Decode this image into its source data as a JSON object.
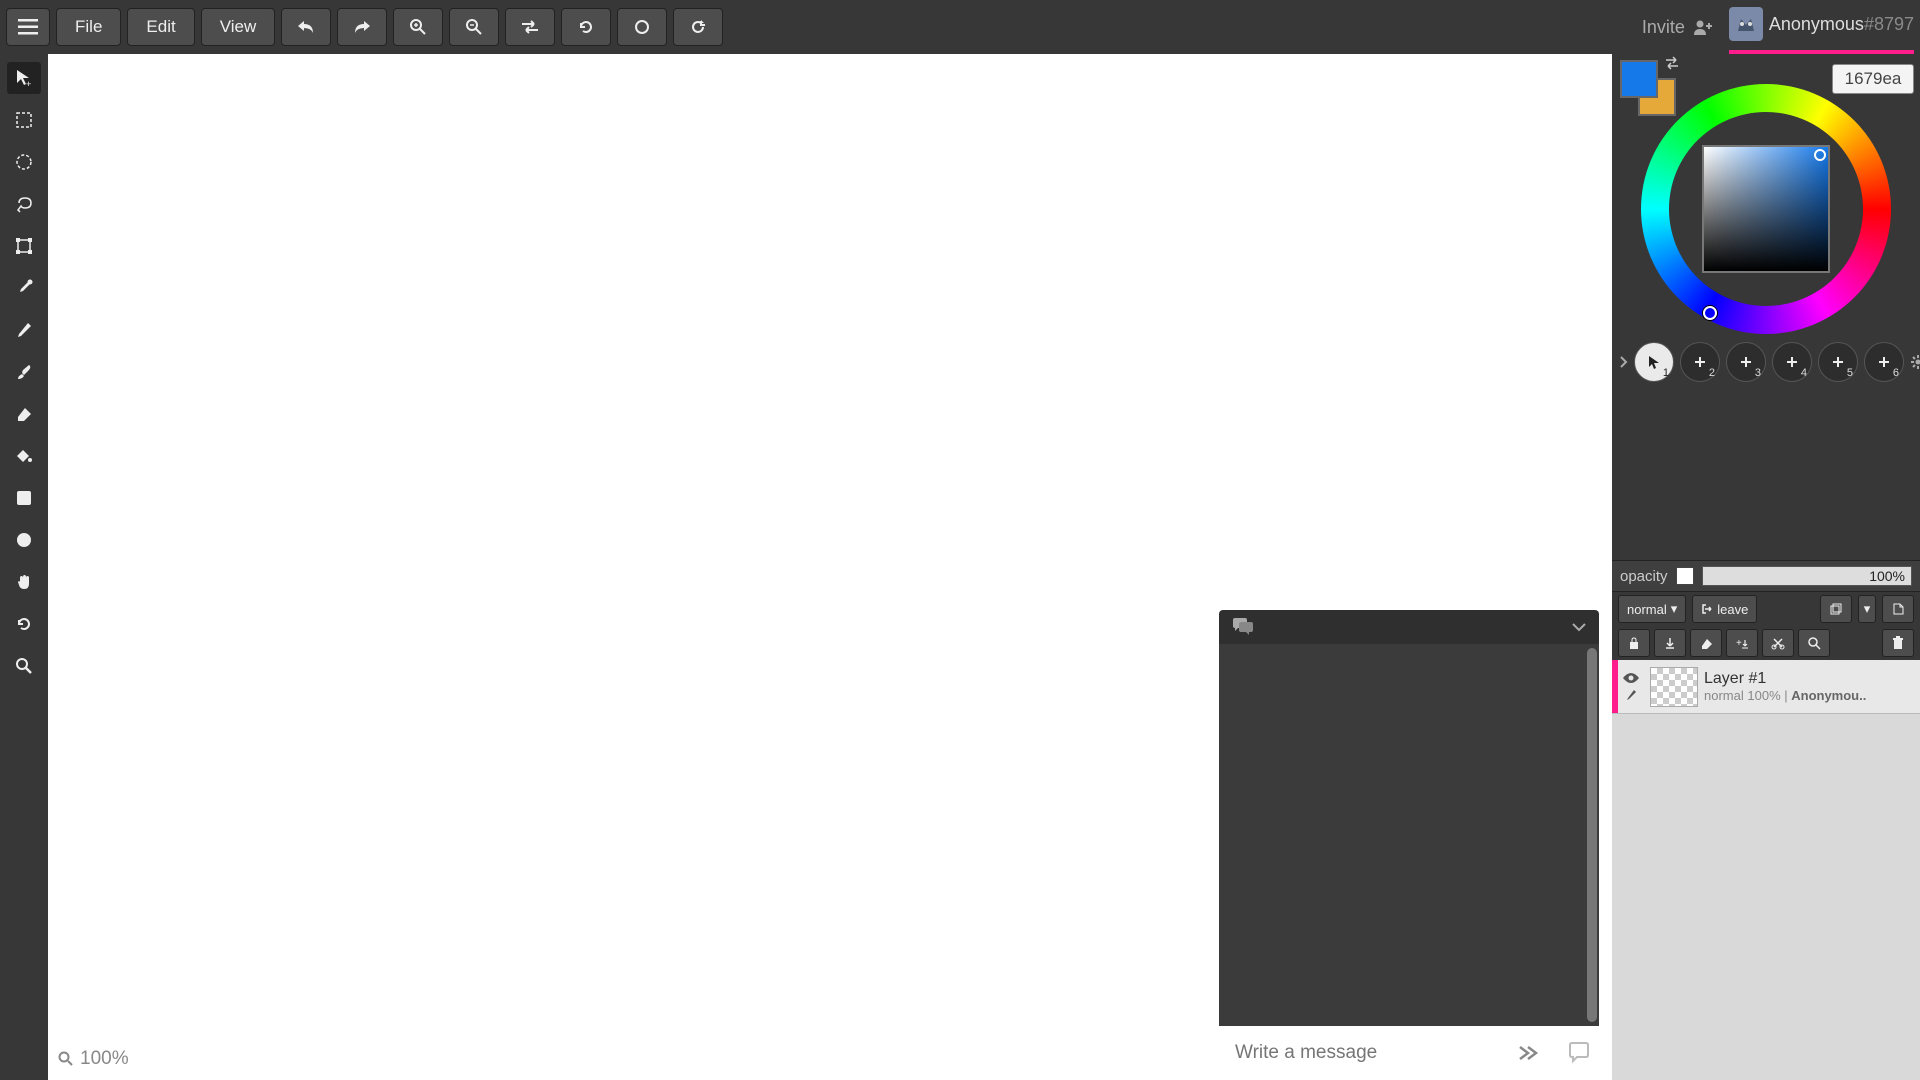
{
  "topbar": {
    "menus": {
      "file": "File",
      "edit": "Edit",
      "view": "View"
    },
    "invite_label": "Invite"
  },
  "user": {
    "name": "Anonymous",
    "tag": "#8797"
  },
  "zoom": {
    "label": "100%",
    "bottom_label": "100%"
  },
  "color": {
    "foreground": "#1679ea",
    "background": "#e4a938",
    "hex": "1679ea"
  },
  "presets": [
    {
      "num": "1",
      "active": true
    },
    {
      "num": "2",
      "active": false
    },
    {
      "num": "3",
      "active": false
    },
    {
      "num": "4",
      "active": false
    },
    {
      "num": "5",
      "active": false
    },
    {
      "num": "6",
      "active": false
    }
  ],
  "opacity": {
    "label": "opacity",
    "value": "100%"
  },
  "blend": {
    "mode": "normal",
    "leave": "leave"
  },
  "layer": {
    "name": "Layer #1",
    "meta_mode": "normal",
    "meta_pct": "100%",
    "meta_owner": "Anonymou.."
  },
  "chat": {
    "placeholder": "Write a message"
  }
}
